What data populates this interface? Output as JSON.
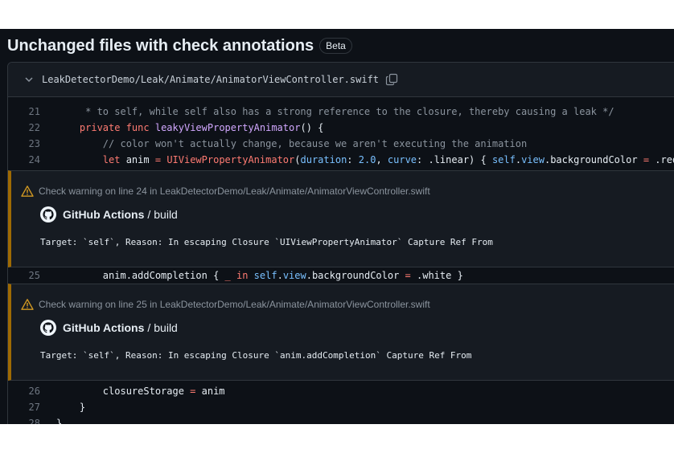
{
  "heading": {
    "title": "Unchanged files with check annotations",
    "badge": "Beta"
  },
  "file": {
    "path": "LeakDetectorDemo/Leak/Animate/AnimatorViewController.swift"
  },
  "lines": {
    "l21": {
      "num": "21",
      "t1": "     * to self, while self also has a strong reference to the closure, thereby causing a leak */"
    },
    "l22": {
      "num": "22",
      "t1": "    ",
      "t2": "private func",
      "t3": " ",
      "t4": "leakyViewPropertyAnimator",
      "t5": "() {"
    },
    "l23": {
      "num": "23",
      "t1": "        ",
      "t2": "// color won't actually change, because we aren't executing the animation"
    },
    "l24": {
      "num": "24",
      "t1": "        ",
      "t2": "let",
      "t3": " anim ",
      "t4": "=",
      "t5": " ",
      "t6": "UIViewPropertyAnimator",
      "t7": "(",
      "t8": "duration",
      "t9": ": ",
      "t10": "2.0",
      "t11": ", ",
      "t12": "curve",
      "t13": ": .linear) { ",
      "t14": "self",
      "t15": ".",
      "t16": "view",
      "t17": ".backgroundColor ",
      "t18": "=",
      "t19": " .red }"
    },
    "l25": {
      "num": "25",
      "t1": "        anim.addCompletion { ",
      "t2": "_",
      "t3": " ",
      "t4": "in",
      "t5": " ",
      "t6": "self",
      "t7": ".",
      "t8": "view",
      "t9": ".backgroundColor ",
      "t10": "=",
      "t11": " .white }"
    },
    "l26": {
      "num": "26",
      "t1": "        closureStorage ",
      "t2": "=",
      "t3": " anim"
    },
    "l27": {
      "num": "27",
      "t1": "    }"
    },
    "l28": {
      "num": "28",
      "t1": "}"
    }
  },
  "annotations": [
    {
      "warning": "Check warning on line 24 in LeakDetectorDemo/Leak/Animate/AnimatorViewController.swift",
      "source": "GitHub Actions",
      "sep": "/",
      "job": "build",
      "message": "Target: `self`, Reason: In escaping Closure `UIViewPropertyAnimator` Capture Ref From"
    },
    {
      "warning": "Check warning on line 25 in LeakDetectorDemo/Leak/Animate/AnimatorViewController.swift",
      "source": "GitHub Actions",
      "sep": "/",
      "job": "build",
      "message": "Target: `self`, Reason: In escaping Closure `anim.addCompletion` Capture Ref From"
    }
  ],
  "icons": {
    "collapse": "chevron-down-icon",
    "copy": "copy-icon",
    "warning": "alert-triangle-icon",
    "actions": "github-mark-icon"
  },
  "colors": {
    "warning": "#9e6a03",
    "keyword": "#ff7b72",
    "function": "#d2a8ff",
    "comment": "#8b949e",
    "constant": "#79c0ff"
  }
}
